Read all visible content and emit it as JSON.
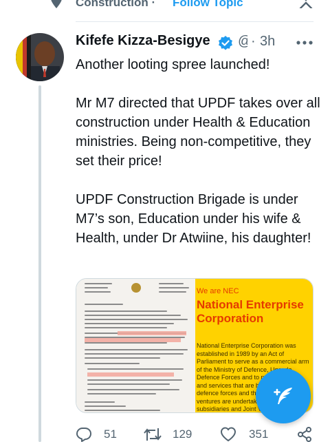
{
  "topic_bar": {
    "topic_label": "Construction ·",
    "follow_label": "Follow Topic",
    "icons": {
      "topic": "pin-icon",
      "close": "close-icon"
    }
  },
  "tweet": {
    "author_name": "Kifefe Kizza-Besigye",
    "handle_fragment": "@",
    "dot": "·",
    "time": "3h",
    "paragraphs": [
      "Another looting spree launched!",
      "Mr M7 directed that UPDF takes over all construction under Health & Education ministries. Being non-competitive, they set their price!",
      "UPDF Construction Brigade is under M7’s son, Education under his wife & Health, under Dr Atwiine, his daughter!"
    ],
    "media": {
      "nec_small": "We are NEC",
      "nec_title": "National Enterprise Corporation",
      "nec_body": "National Enterprise Corporation was established in 1989 by an Act of Parliament to serve as a commercial arm of the Ministry of Defence, Uganda Defence Forces and to produce goods and services that are beneficial to the defence forces and the general public. Its ventures are undertaken through subsidiaries and Joint Ventures."
    },
    "counts": {
      "replies": "51",
      "retweets": "129",
      "likes": "351"
    }
  },
  "colors": {
    "accent": "#1d9bf0",
    "secondary_text": "#536471",
    "nec_yellow": "#ffd200",
    "nec_orange": "#e53a00"
  }
}
